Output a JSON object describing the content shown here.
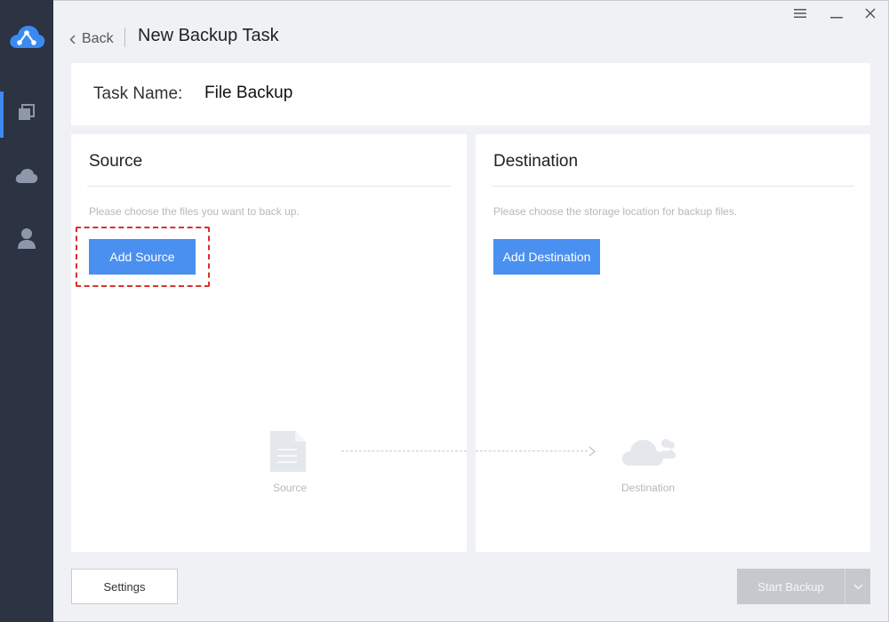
{
  "window": {
    "controls": [
      "menu-icon",
      "minimize-icon",
      "close-icon"
    ]
  },
  "sidebar": {
    "items": [
      {
        "name": "backup",
        "icon": "copy-icon",
        "active": true
      },
      {
        "name": "cloud",
        "icon": "cloud-icon",
        "active": false
      },
      {
        "name": "account",
        "icon": "user-icon",
        "active": false
      }
    ]
  },
  "header": {
    "back_label": "Back",
    "title": "New Backup Task"
  },
  "task": {
    "label": "Task Name:",
    "value": "File Backup"
  },
  "source_panel": {
    "title": "Source",
    "hint": "Please choose the files you want to back up.",
    "button_label": "Add Source"
  },
  "dest_panel": {
    "title": "Destination",
    "hint": "Please choose the storage location for backup files.",
    "button_label": "Add Destination"
  },
  "flow": {
    "source_label": "Source",
    "dest_label": "Destination"
  },
  "footer": {
    "settings_label": "Settings",
    "start_label": "Start Backup"
  },
  "colors": {
    "accent": "#4a90f1",
    "sidebar_bg": "#2c3342",
    "highlight": "#d9302c",
    "disabled": "#c5c8cd"
  }
}
